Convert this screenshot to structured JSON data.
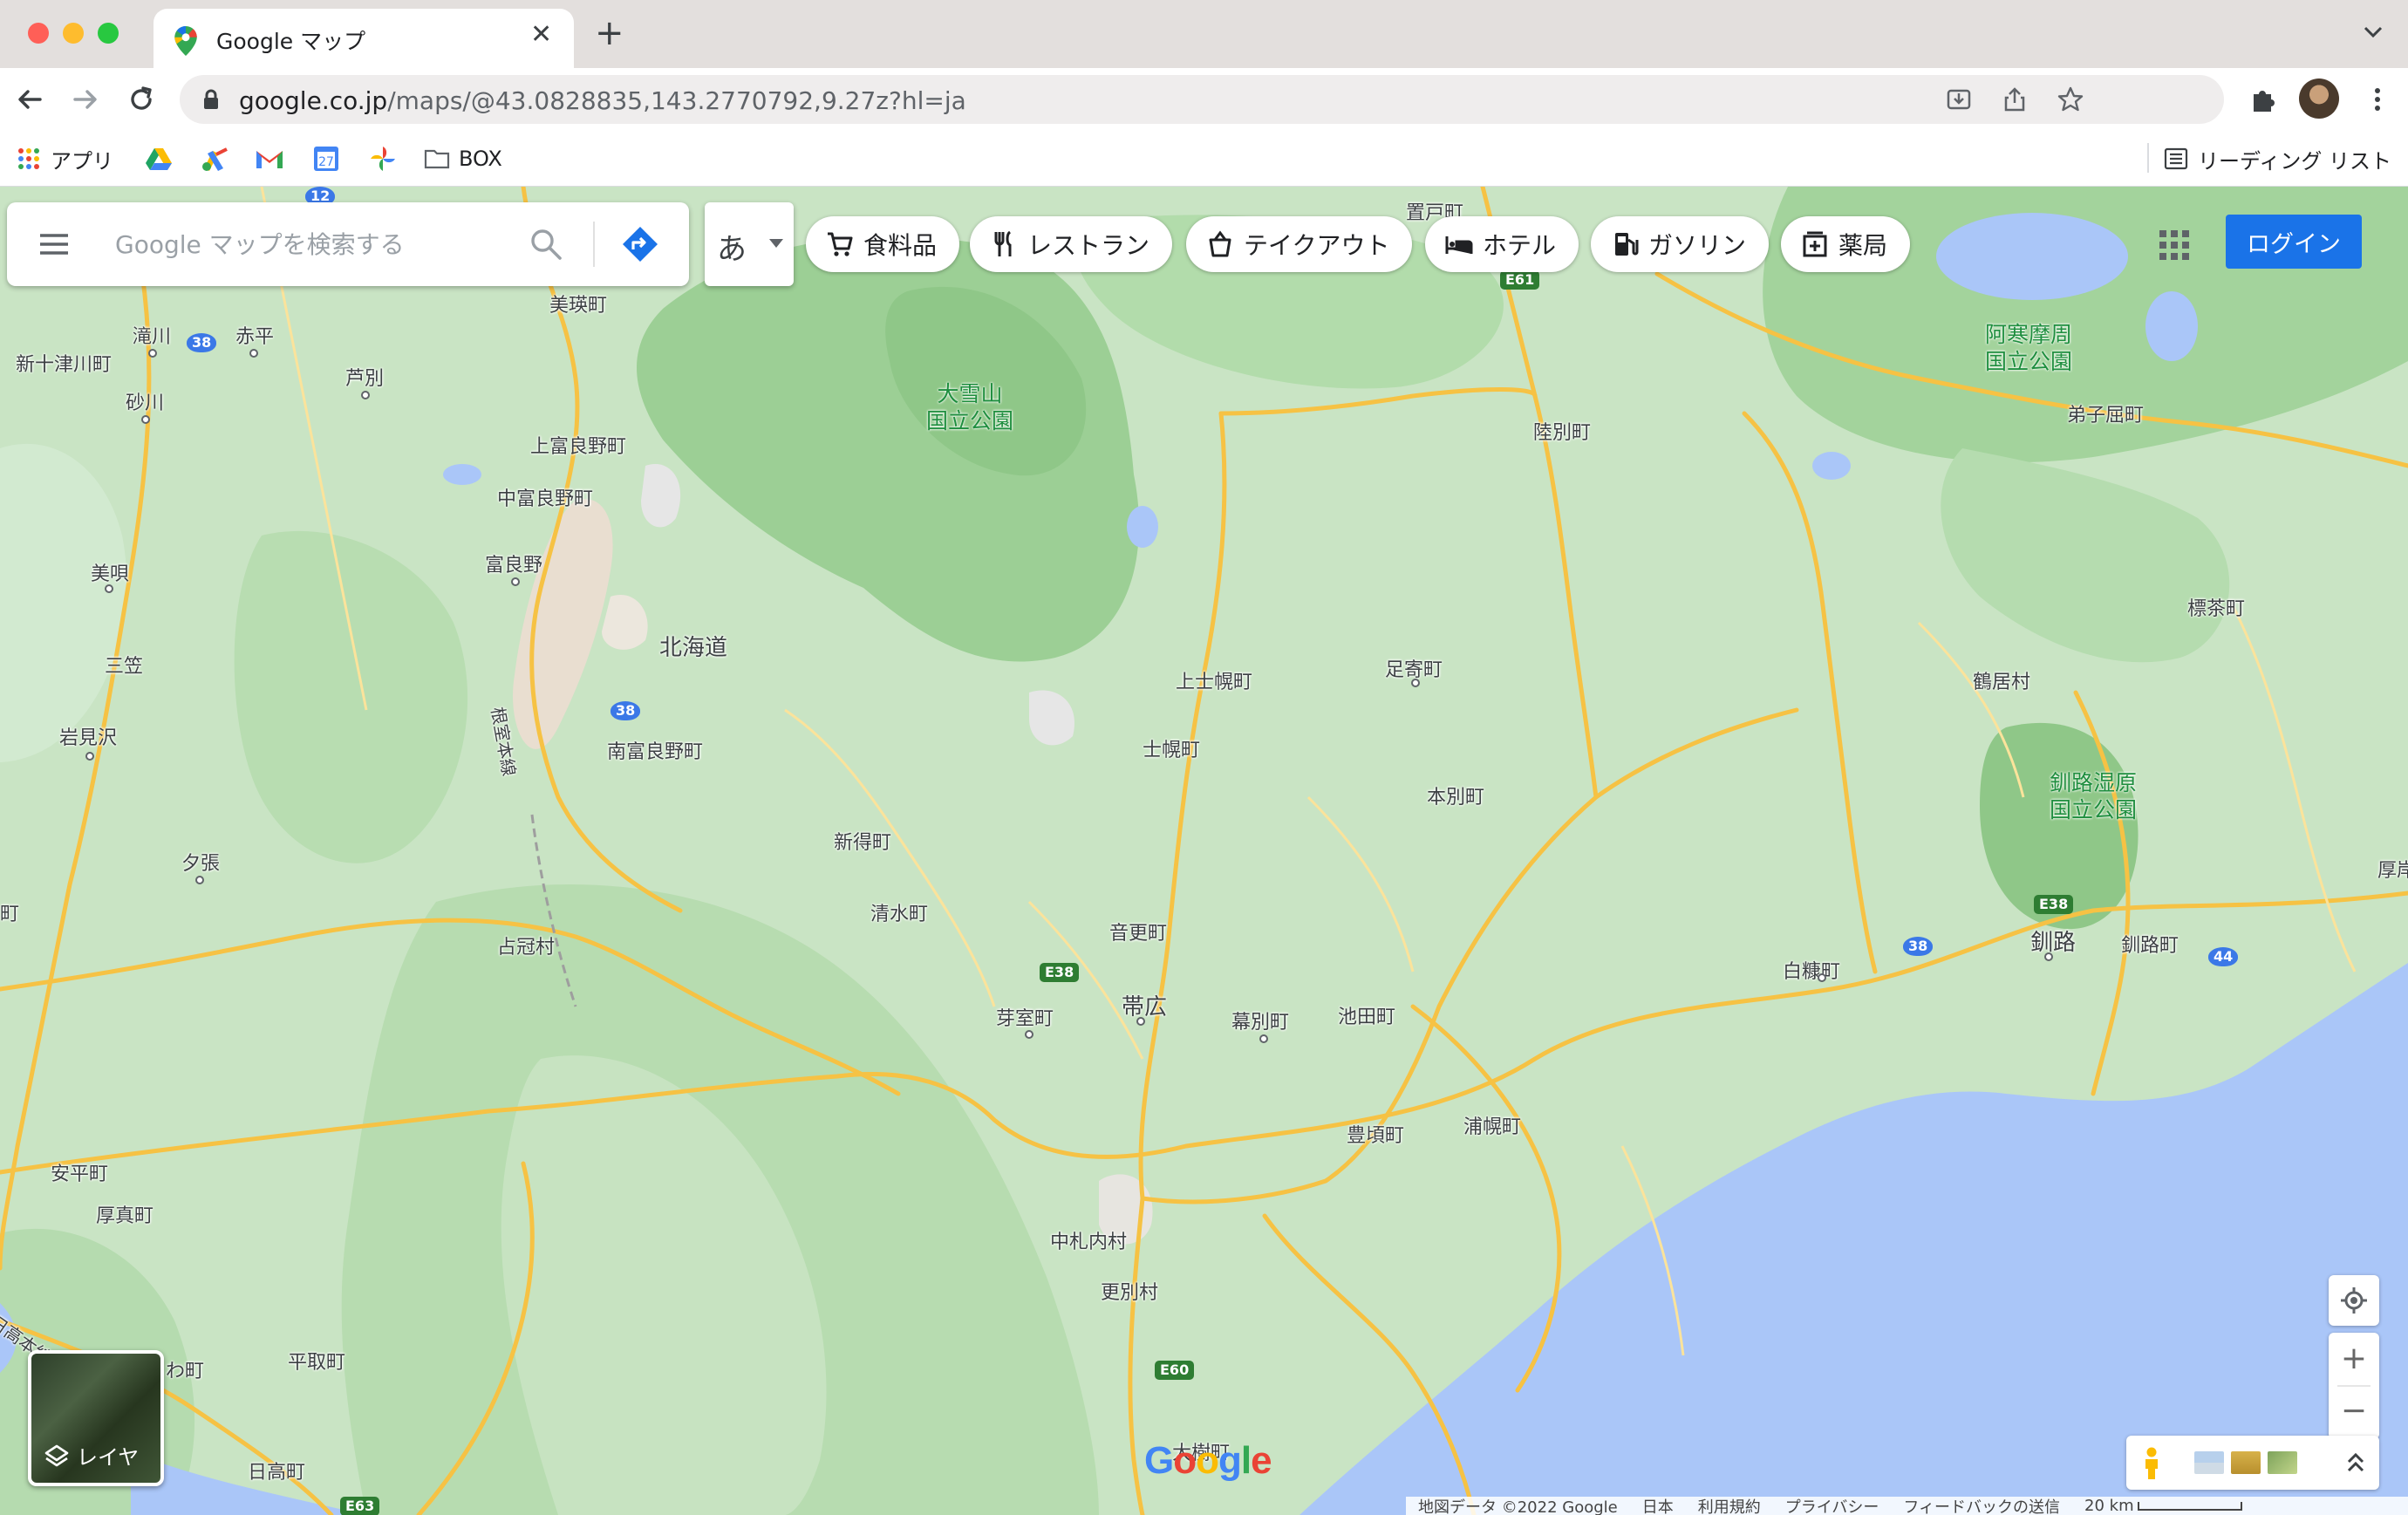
{
  "browser": {
    "tab_title": "Google マップ",
    "url_host": "google.co.jp",
    "url_path": "/maps/@43.0828835,143.2770792,9.27z?hl=ja",
    "bookmarks": {
      "apps": "アプリ",
      "folder": "BOX",
      "reading_list": "リーディング リスト"
    }
  },
  "maps": {
    "search_placeholder": "Google マップを検索する",
    "ime_char": "あ",
    "chips": [
      "食料品",
      "レストラン",
      "テイクアウト",
      "ホテル",
      "ガソリン",
      "薬局"
    ],
    "login": "ログイン",
    "layer_label": "レイヤ",
    "zoom_in": "+",
    "zoom_out": "−",
    "google_logo": "Google",
    "footer": {
      "map_data": "地図データ ©2022 Google",
      "region": "日本",
      "terms": "利用規約",
      "privacy": "プライバシー",
      "feedback": "フィードバックの送信",
      "scale": "20 km"
    },
    "labels": {
      "hokkaido": "北海道",
      "daisetsuzan": "大雪山\n国立公園",
      "akan": "阿寒摩周\n国立公園",
      "kushiro_shitsugen": "釧路湿原\n国立公園",
      "places": [
        "置戸町",
        "美瑛町",
        "滝川",
        "赤平",
        "新十津川町",
        "砂川",
        "芦別",
        "上富良野町",
        "中富良野町",
        "富良野",
        "美唄",
        "三笠",
        "岩見沢",
        "夕張",
        "南富良野町",
        "新得町",
        "清水町",
        "占冠村",
        "上士幌町",
        "士幌町",
        "足寄町",
        "陸別町",
        "本別町",
        "音更町",
        "芽室町",
        "帯広",
        "幕別町",
        "池田町",
        "豊頃町",
        "浦幌町",
        "中札内村",
        "更別村",
        "大樹町",
        "平取町",
        "日高町",
        "安平町",
        "厚真町",
        "わ町",
        "弟子屈町",
        "標茶町",
        "鶴居村",
        "白糠町",
        "釧路",
        "釧路町",
        "厚岸",
        "根室本線",
        "日高本線",
        "町"
      ]
    },
    "shields": [
      "12",
      "38",
      "38",
      "E38",
      "38",
      "E38",
      "44",
      "E61",
      "E60",
      "E63"
    ],
    "colors": {
      "land": "#c9e4c4",
      "forest": "#a8d5a2",
      "water": "#aac6f8",
      "road": "#f6c244",
      "accent": "#1a73e8"
    }
  }
}
